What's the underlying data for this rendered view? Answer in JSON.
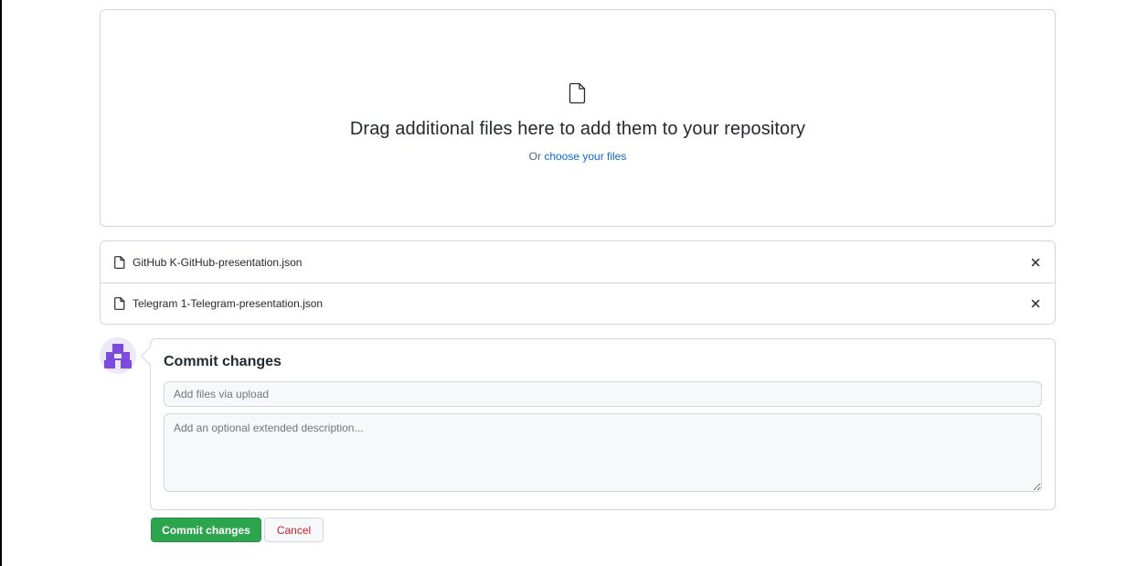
{
  "dropzone": {
    "icon": "file-icon",
    "heading": "Drag additional files here to add them to your repository",
    "sub_prefix": "Or",
    "choose_link": "choose your files"
  },
  "files": [
    {
      "name": "GitHub K-GitHub-presentation.json",
      "icon": "file-icon",
      "remove_icon": "x-icon"
    },
    {
      "name": "Telegram 1-Telegram-presentation.json",
      "icon": "file-icon",
      "remove_icon": "x-icon"
    }
  ],
  "commit": {
    "title": "Commit changes",
    "summary_placeholder": "Add files via upload",
    "summary_value": "",
    "description_placeholder": "Add an optional extended description...",
    "description_value": "",
    "commit_button": "Commit changes",
    "cancel_button": "Cancel"
  },
  "colors": {
    "accent_link": "#0969da",
    "commit_green": "#2da44e",
    "cancel_red": "#cf222e",
    "avatar_purple": "#7d4ae0"
  }
}
